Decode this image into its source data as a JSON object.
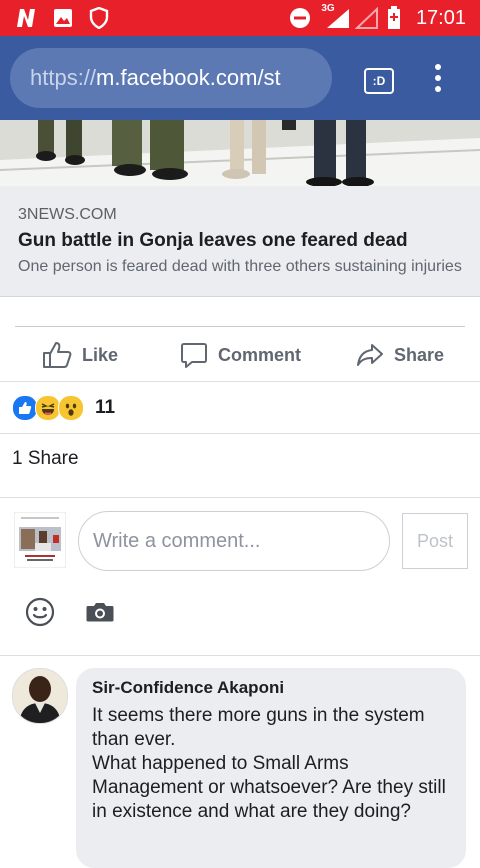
{
  "status_bar": {
    "time": "17:01",
    "network_label": "3G",
    "left_icons": [
      "n-app-icon",
      "image-icon",
      "shield-icon"
    ],
    "right_icons": [
      "do-not-disturb-icon",
      "signal-icon",
      "signal-empty-icon",
      "battery-charging-icon"
    ]
  },
  "browser": {
    "url_scheme": "https://",
    "url_rest": "m.facebook.com/st",
    "tab_switcher_label": ":D",
    "menu_icon": "kebab-menu-icon"
  },
  "link_preview": {
    "domain": "3NEWS.COM",
    "title": "Gun battle in Gonja leaves one feared dead",
    "description": "One person is feared dead with three others sustaining injuries"
  },
  "actions": {
    "like_label": "Like",
    "comment_label": "Comment",
    "share_label": "Share"
  },
  "reactions": {
    "icons": [
      "like-reaction-icon",
      "haha-reaction-icon",
      "wow-reaction-icon"
    ],
    "count": "11"
  },
  "shares": {
    "label": "1 Share"
  },
  "composer": {
    "placeholder": "Write a comment...",
    "post_label": "Post",
    "tools": [
      "emoji-icon",
      "camera-icon"
    ]
  },
  "comments": [
    {
      "author": "Sir-Confidence Akaponi",
      "text": "It seems there more guns in the system than ever.\nWhat happened to Small Arms Management or whatsoever? Are they still in existence and what are they doing?"
    }
  ],
  "colors": {
    "status_bar": "#e8202a",
    "url_bar": "#3a5ba0",
    "link_card_bg": "#ebedf0",
    "action_text": "#606770",
    "like_blue": "#1877f2",
    "reaction_yellow": "#f7c531"
  }
}
